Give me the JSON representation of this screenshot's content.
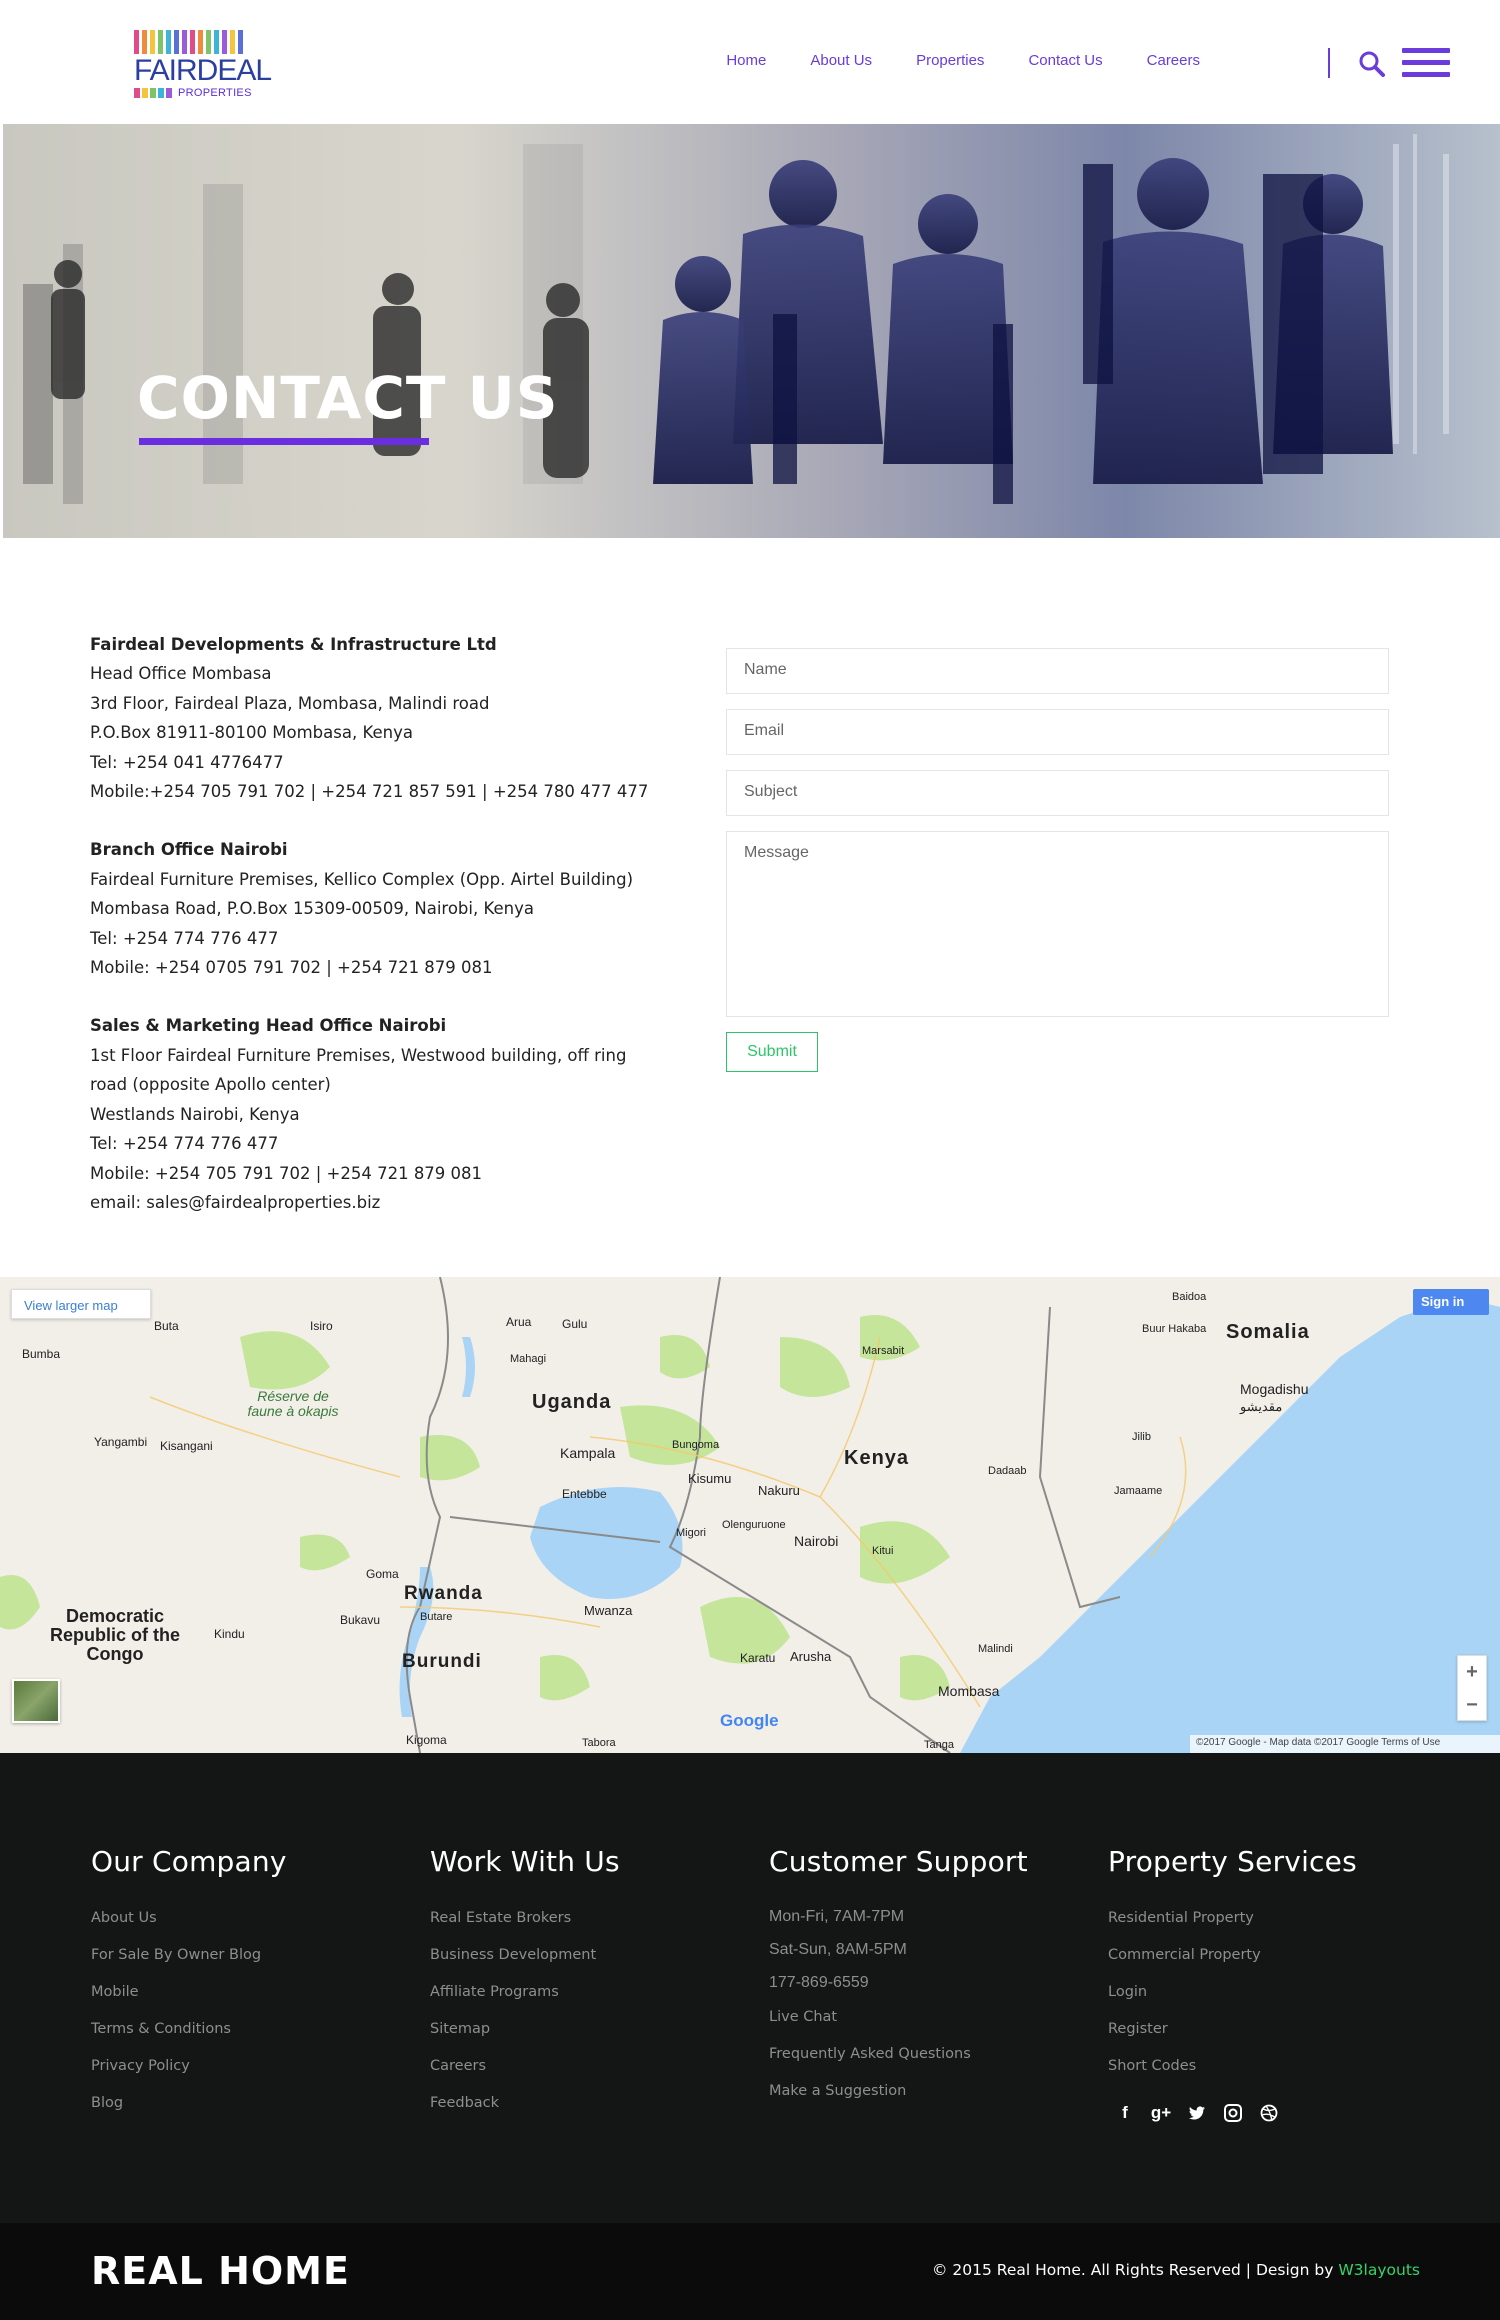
{
  "header": {
    "logo": {
      "word": "FAIRDEAL",
      "sub": "PROPERTIES"
    },
    "nav": [
      "Home",
      "About Us",
      "Properties",
      "Contact Us",
      "Careers"
    ]
  },
  "hero": {
    "title": "CONTACT US"
  },
  "contact": {
    "head_office": {
      "name": "Fairdeal Developments & Infrastructure Ltd",
      "lines": [
        "Head Office Mombasa",
        "3rd Floor, Fairdeal Plaza, Mombasa, Malindi road",
        "P.O.Box 81911-80100 Mombasa, Kenya",
        "Tel: +254 041 4776477",
        "Mobile:+254 705 791 702 | +254 721 857 591 | +254 780 477 477"
      ]
    },
    "branch_office": {
      "name": "Branch Office Nairobi",
      "lines": [
        "Fairdeal Furniture Premises, Kellico Complex (Opp. Airtel Building)",
        "Mombasa Road, P.O.Box 15309-00509, Nairobi, Kenya",
        "Tel: +254 774 776 477",
        "Mobile: +254 0705 791 702 | +254 721 879 081"
      ]
    },
    "sales_office": {
      "name": "Sales & Marketing Head Office Nairobi",
      "lines": [
        "1st Floor Fairdeal Furniture Premises, Westwood building, off ring",
        "road (opposite Apollo center)",
        "Westlands  Nairobi, Kenya",
        "Tel: +254 774 776 477",
        "Mobile: +254 705 791 702 | +254 721 879 081",
        "email: sales@fairdealproperties.biz"
      ]
    }
  },
  "form": {
    "name_placeholder": "Name",
    "email_placeholder": "Email",
    "subject_placeholder": "Subject",
    "message_placeholder": "Message",
    "submit_label": "Submit"
  },
  "map": {
    "view_larger": "View larger map",
    "sign_in": "Sign in",
    "zoom_in": "+",
    "zoom_out": "−",
    "google": "Google",
    "attribution": "©2017 Google - Map data ©2017 Google    Terms of Use",
    "labels": {
      "uganda": "Uganda",
      "kenya": "Kenya",
      "somalia": "Somalia",
      "rwanda": "Rwanda",
      "burundi": "Burundi",
      "drc": "Democratic Republic of the Congo",
      "reserve": "Réserve de faune à okapis",
      "kampala": "Kampala",
      "entebbe": "Entebbe",
      "nairobi": "Nairobi",
      "mombasa": "Mombasa",
      "mogadishu": "Mogadishu",
      "mogadishu_ar": "مقديشو",
      "nakuru": "Nakuru",
      "kisumu": "Kisumu",
      "mwanza": "Mwanza",
      "kigoma": "Kigoma",
      "arusha": "Arusha",
      "karatu": "Karatu",
      "kisangani": "Kisangani",
      "bumba": "Bumba",
      "yangambi": "Yangambi",
      "buta": "Buta",
      "isiro": "Isiro",
      "arua": "Arua",
      "gulu": "Gulu",
      "mahagi": "Mahagi",
      "bungoma": "Bungoma",
      "marsabit": "Marsabit",
      "baidoa": "Baidoa",
      "buur_hakaba": "Buur Hakaba",
      "jilib": "Jilib",
      "jamaame": "Jamaame",
      "dadaab": "Dadaab",
      "kitui": "Kitui",
      "malindi": "Malindi",
      "goma": "Goma",
      "bukavu": "Bukavu",
      "butare": "Butare",
      "kindu": "Kindu",
      "migori": "Migori",
      "olenguruone": "Olenguruone",
      "tabora": "Tabora",
      "tanga": "Tanga"
    }
  },
  "footer": {
    "company": {
      "title": "Our Company",
      "links": [
        "About Us",
        "For Sale By Owner Blog",
        "Mobile",
        "Terms & Conditions",
        "Privacy Policy",
        "Blog"
      ]
    },
    "work": {
      "title": "Work With Us",
      "links": [
        "Real Estate Brokers",
        "Business Development",
        "Affiliate Programs",
        "Sitemap",
        "Careers",
        "Feedback"
      ]
    },
    "support": {
      "title": "Customer Support",
      "hours": [
        "Mon-Fri, 7AM-7PM",
        "Sat-Sun, 8AM-5PM",
        "177-869-6559"
      ],
      "links": [
        "Live Chat",
        "Frequently Asked Questions",
        "Make a Suggestion"
      ]
    },
    "services": {
      "title": "Property Services",
      "links": [
        "Residential Property",
        "Commercial Property",
        "Login",
        "Register",
        "Short Codes"
      ]
    },
    "social": [
      "facebook-icon",
      "google-plus-icon",
      "twitter-icon",
      "instagram-icon",
      "dribbble-icon"
    ]
  },
  "bottom": {
    "brand": "REAL HOME",
    "copyright": "© 2015 Real Home. All Rights Reserved | Design by ",
    "designer": "W3layouts"
  },
  "colors": {
    "accent": "#6a3cdb",
    "green": "#2ec46a",
    "footer_bg": "#141515"
  }
}
